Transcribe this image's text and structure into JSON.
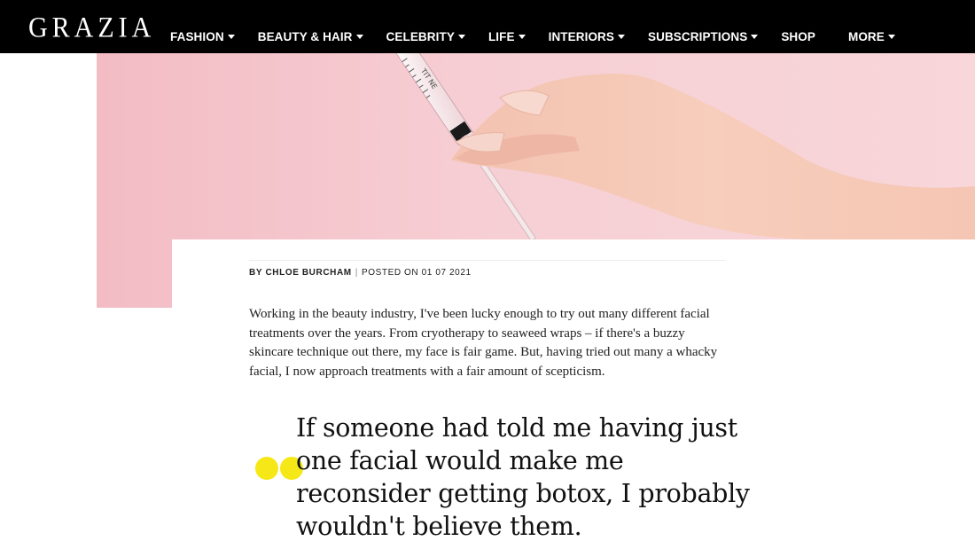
{
  "brand": {
    "logo": "GRAZIA"
  },
  "nav": {
    "items": [
      {
        "label": "FASHION"
      },
      {
        "label": "BEAUTY & HAIR"
      },
      {
        "label": "CELEBRITY"
      },
      {
        "label": "LIFE"
      },
      {
        "label": "INTERIORS"
      },
      {
        "label": "SUBSCRIPTIONS"
      },
      {
        "label": "SHOP"
      },
      {
        "label": "MORE"
      }
    ]
  },
  "hero": {
    "syringe_marking": "TIT NE"
  },
  "article": {
    "byline_prefix": "BY",
    "author": "CHLOE BURCHAM",
    "posted": "POSTED ON 01 07 2021",
    "intro": "Working in the beauty industry, I've been lucky enough to try out many different facial treatments over the years. From cryotherapy to seaweed wraps – if there's a buzzy skincare technique out there, my face is fair game. But, having tried out many a whacky facial, I now approach treatments with a fair amount of scepticism.",
    "pullquote": "If someone had told me having just one facial would make me reconsider getting botox, I probably wouldn't believe them."
  },
  "colors": {
    "topbar": "#000000",
    "hero_pink": "#f5c9cf",
    "quote_accent": "#f5e816"
  }
}
